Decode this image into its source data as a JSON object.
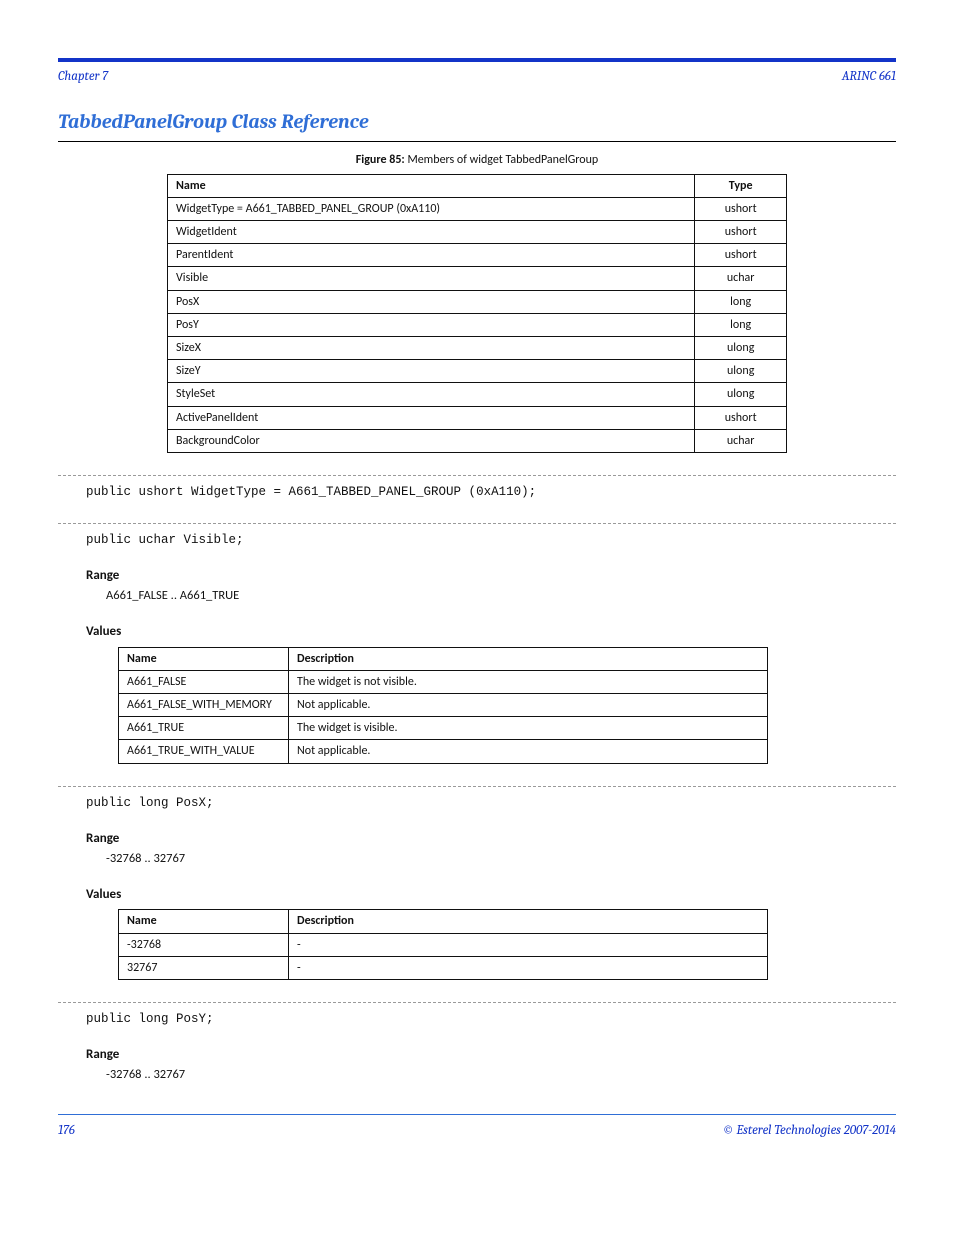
{
  "header": {
    "left": "Chapter 7",
    "right": "ARINC 661"
  },
  "section_title": "TabbedPanelGroup Class Reference",
  "members_table": {
    "caption_label": "Figure 85:",
    "caption_desc": " Members of widget TabbedPanelGroup",
    "headers": [
      "Name",
      "Type"
    ],
    "rows": [
      [
        "WidgetType",
        "A661_TABBED_PANEL_GROUP (0xA110)",
        "ushort"
      ],
      [
        "WidgetIdent",
        "",
        "ushort"
      ],
      [
        "ParentIdent",
        "",
        "ushort"
      ],
      [
        "Visible",
        "",
        "uchar"
      ],
      [
        "PosX",
        "",
        "long"
      ],
      [
        "PosY",
        "",
        "long"
      ],
      [
        "SizeX",
        "",
        "ulong"
      ],
      [
        "SizeY",
        "",
        "ulong"
      ],
      [
        "StyleSet",
        "",
        "ulong"
      ],
      [
        "ActivePanelIdent",
        "",
        "ushort"
      ],
      [
        "BackgroundColor",
        "",
        "uchar"
      ]
    ]
  },
  "entries": [
    {
      "sig": "public ushort WidgetType = A661_TABBED_PANEL_GROUP (0xA110);",
      "range": null,
      "values": null
    },
    {
      "sig": "public uchar Visible;",
      "range": "A661_FALSE .. A661_TRUE",
      "values": {
        "headers": [
          "Name",
          "Description"
        ],
        "rows": [
          [
            "A661_FALSE",
            "The widget is not visible."
          ],
          [
            "A661_FALSE_WITH_MEMORY",
            "Not applicable."
          ],
          [
            "A661_TRUE",
            "The widget is visible."
          ],
          [
            "A661_TRUE_WITH_VALUE",
            "Not applicable."
          ]
        ]
      }
    },
    {
      "sig": "public long PosX;",
      "range": "-32768 .. 32767",
      "values": {
        "headers": [
          "Name",
          "Description"
        ],
        "rows": [
          [
            "-32768",
            "-"
          ],
          [
            "32767",
            "-"
          ]
        ]
      }
    },
    {
      "sig": "public long PosY;",
      "range": "-32768 .. 32767",
      "values": null
    }
  ],
  "labels": {
    "range": "Range",
    "values": "Values"
  },
  "footer": {
    "left": "176",
    "right": "© Esterel Technologies 2007-2014"
  }
}
